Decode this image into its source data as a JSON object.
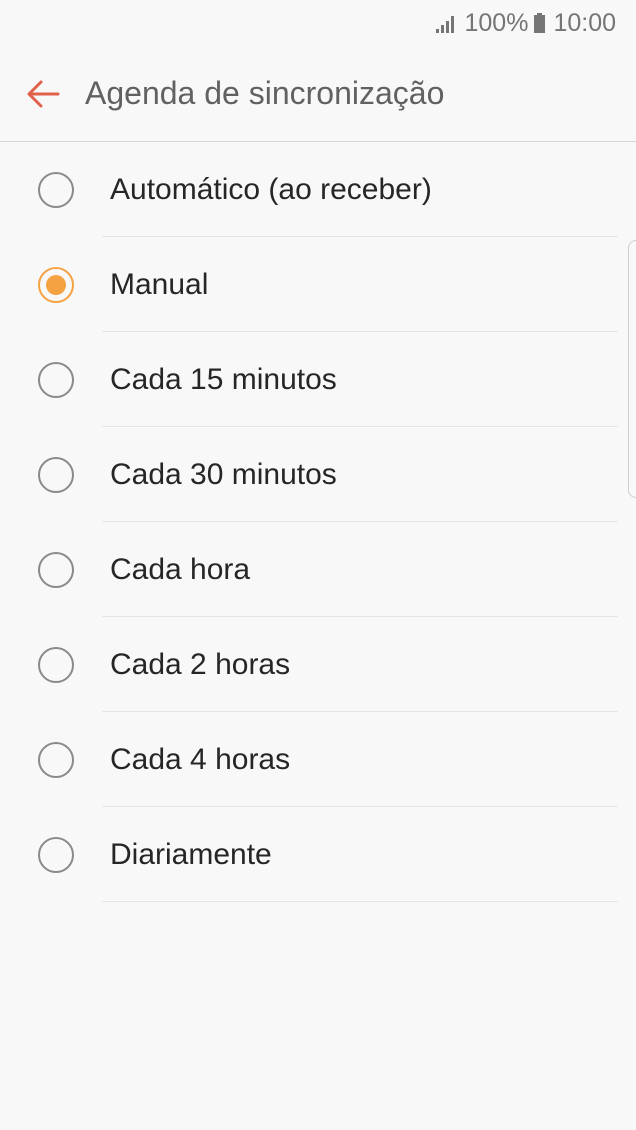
{
  "status_bar": {
    "signal_icon": "signal-bars-icon",
    "battery_percent": "100%",
    "battery_icon": "battery-icon",
    "time": "10:00",
    "color": "#757575"
  },
  "app_bar": {
    "back_icon": "arrow-left-icon",
    "back_icon_color": "#e0614a",
    "title": "Agenda de sincronização"
  },
  "options": [
    {
      "label": "Automático (ao receber)",
      "selected": false
    },
    {
      "label": "Manual",
      "selected": true
    },
    {
      "label": "Cada 15 minutos",
      "selected": false
    },
    {
      "label": "Cada 30 minutos",
      "selected": false
    },
    {
      "label": "Cada hora",
      "selected": false
    },
    {
      "label": "Cada 2 horas",
      "selected": false
    },
    {
      "label": "Cada 4 horas",
      "selected": false
    },
    {
      "label": "Diariamente",
      "selected": false
    }
  ],
  "colors": {
    "accent": "#f5a243",
    "background": "#f8f8f8",
    "text": "#262626"
  }
}
